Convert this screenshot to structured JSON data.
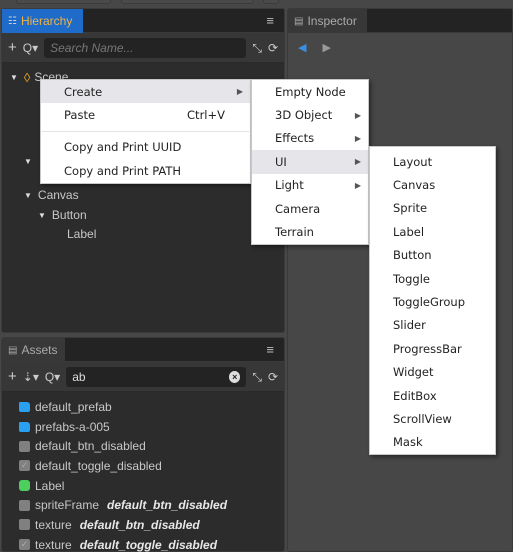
{
  "hierarchy": {
    "tab_label": "Hierarchy",
    "tab_icon": "hierarchy-icon",
    "search_placeholder": "Search Name...",
    "search_value": "",
    "tree": [
      {
        "label": "Scene",
        "depth": 0,
        "expanded": true,
        "icon": "scene-icon"
      },
      {
        "label": "",
        "depth": 1,
        "expanded": true
      },
      {
        "label": "Canvas",
        "depth": 1,
        "expanded": true
      },
      {
        "label": "Button",
        "depth": 2,
        "expanded": true
      },
      {
        "label": "Label",
        "depth": 3,
        "expanded": false
      }
    ]
  },
  "inspector": {
    "tab_label": "Inspector",
    "tab_icon": "inspector-icon"
  },
  "assets": {
    "tab_label": "Assets",
    "tab_icon": "assets-icon",
    "search_value": "ab",
    "items": [
      {
        "icon": "folder-icon",
        "label": "default_prefab",
        "sub": ""
      },
      {
        "icon": "folder-icon",
        "label": "prefabs-a-005",
        "sub": ""
      },
      {
        "icon": "image-icon",
        "label": "default_btn_disabled",
        "sub": ""
      },
      {
        "icon": "checkbox-image-icon",
        "label": "default_toggle_disabled",
        "sub": ""
      },
      {
        "icon": "prefab-cube-icon",
        "label": "Label",
        "sub": ""
      },
      {
        "icon": "image-icon",
        "label": "spriteFrame",
        "sub": "default_btn_disabled"
      },
      {
        "icon": "image-icon",
        "label": "texture",
        "sub": "default_btn_disabled"
      },
      {
        "icon": "checkbox-image-icon",
        "label": "texture",
        "sub": "default_toggle_disabled"
      }
    ]
  },
  "context_menu": {
    "items": [
      {
        "label": "Create",
        "shortcut": "",
        "submenu": true,
        "highlighted": true
      },
      {
        "label": "Paste",
        "shortcut": "Ctrl+V",
        "submenu": false,
        "highlighted": false
      },
      {
        "separator": true
      },
      {
        "label": "Copy and Print UUID",
        "shortcut": "",
        "submenu": false,
        "highlighted": false
      },
      {
        "label": "Copy and Print PATH",
        "shortcut": "",
        "submenu": false,
        "highlighted": false
      }
    ]
  },
  "create_menu": {
    "items": [
      {
        "label": "Empty Node",
        "submenu": false,
        "highlighted": false
      },
      {
        "label": "3D Object",
        "submenu": true,
        "highlighted": false
      },
      {
        "label": "Effects",
        "submenu": true,
        "highlighted": false
      },
      {
        "label": "UI",
        "submenu": true,
        "highlighted": true
      },
      {
        "label": "Light",
        "submenu": true,
        "highlighted": false
      },
      {
        "label": "Camera",
        "submenu": false,
        "highlighted": false
      },
      {
        "label": "Terrain",
        "submenu": false,
        "highlighted": false
      }
    ]
  },
  "ui_menu": {
    "items": [
      "Layout",
      "Canvas",
      "Sprite",
      "Label",
      "Button",
      "Toggle",
      "ToggleGroup",
      "Slider",
      "ProgressBar",
      "Widget",
      "EditBox",
      "ScrollView",
      "Mask"
    ]
  },
  "colors": {
    "accent_blue": "#1e6bc9",
    "hierarchy_tab_text": "#f0b445",
    "folder": "#2aa0f0",
    "prefab": "#4ccf5c",
    "scene_icon": "#f0a020"
  }
}
